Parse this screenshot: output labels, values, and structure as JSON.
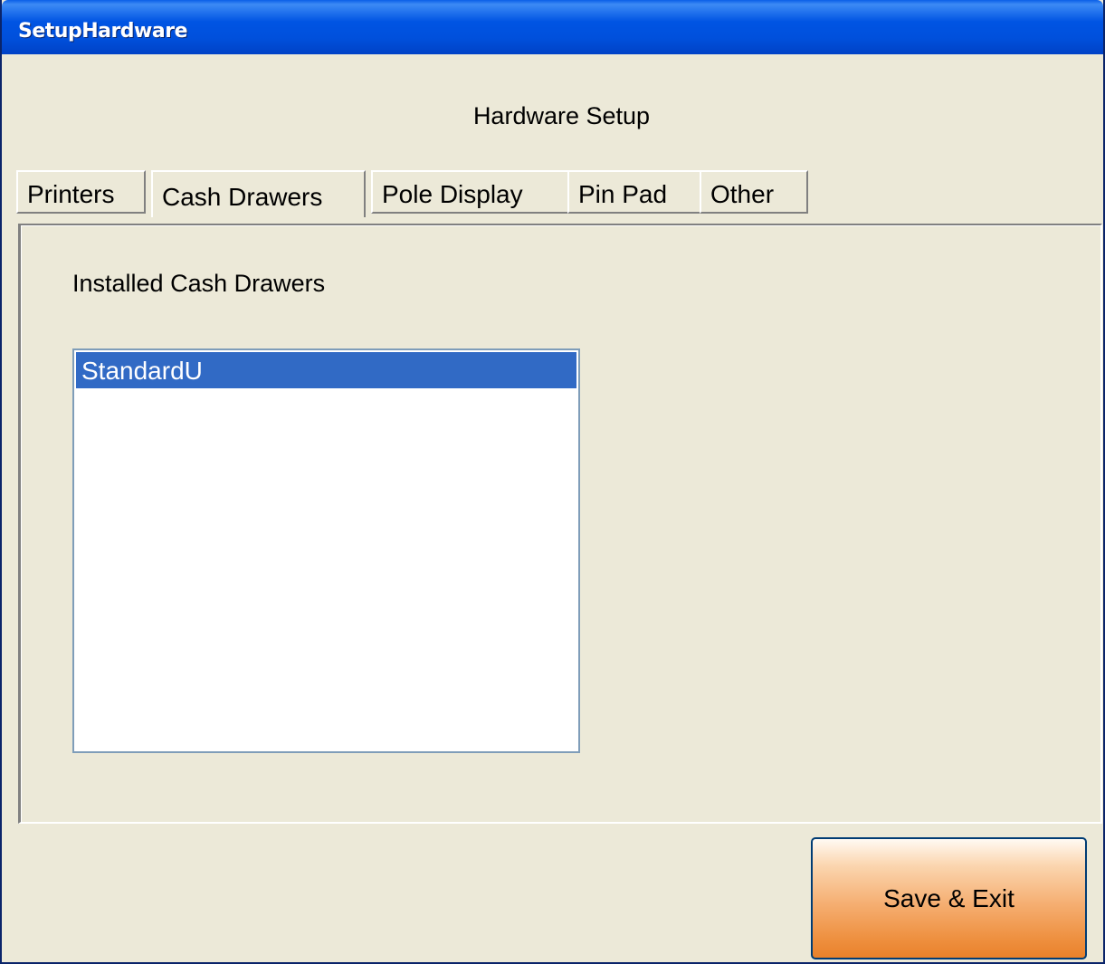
{
  "window": {
    "title": "SetupHardware"
  },
  "header": {
    "title": "Hardware Setup"
  },
  "tabs": [
    {
      "label": "Printers",
      "active": false
    },
    {
      "label": "Cash Drawers",
      "active": true
    },
    {
      "label": "Pole Display",
      "active": false
    },
    {
      "label": "Pin Pad",
      "active": false
    },
    {
      "label": "Other",
      "active": false
    }
  ],
  "cash_drawers": {
    "section_label": "Installed Cash Drawers",
    "items": [
      "StandardU"
    ],
    "selected_index": 0
  },
  "footer": {
    "save_label": "Save & Exit"
  },
  "colors": {
    "titlebar": "#0054e3",
    "window_bg": "#ece9d8",
    "selection": "#316ac5",
    "save_button": "#ee8f3e"
  }
}
